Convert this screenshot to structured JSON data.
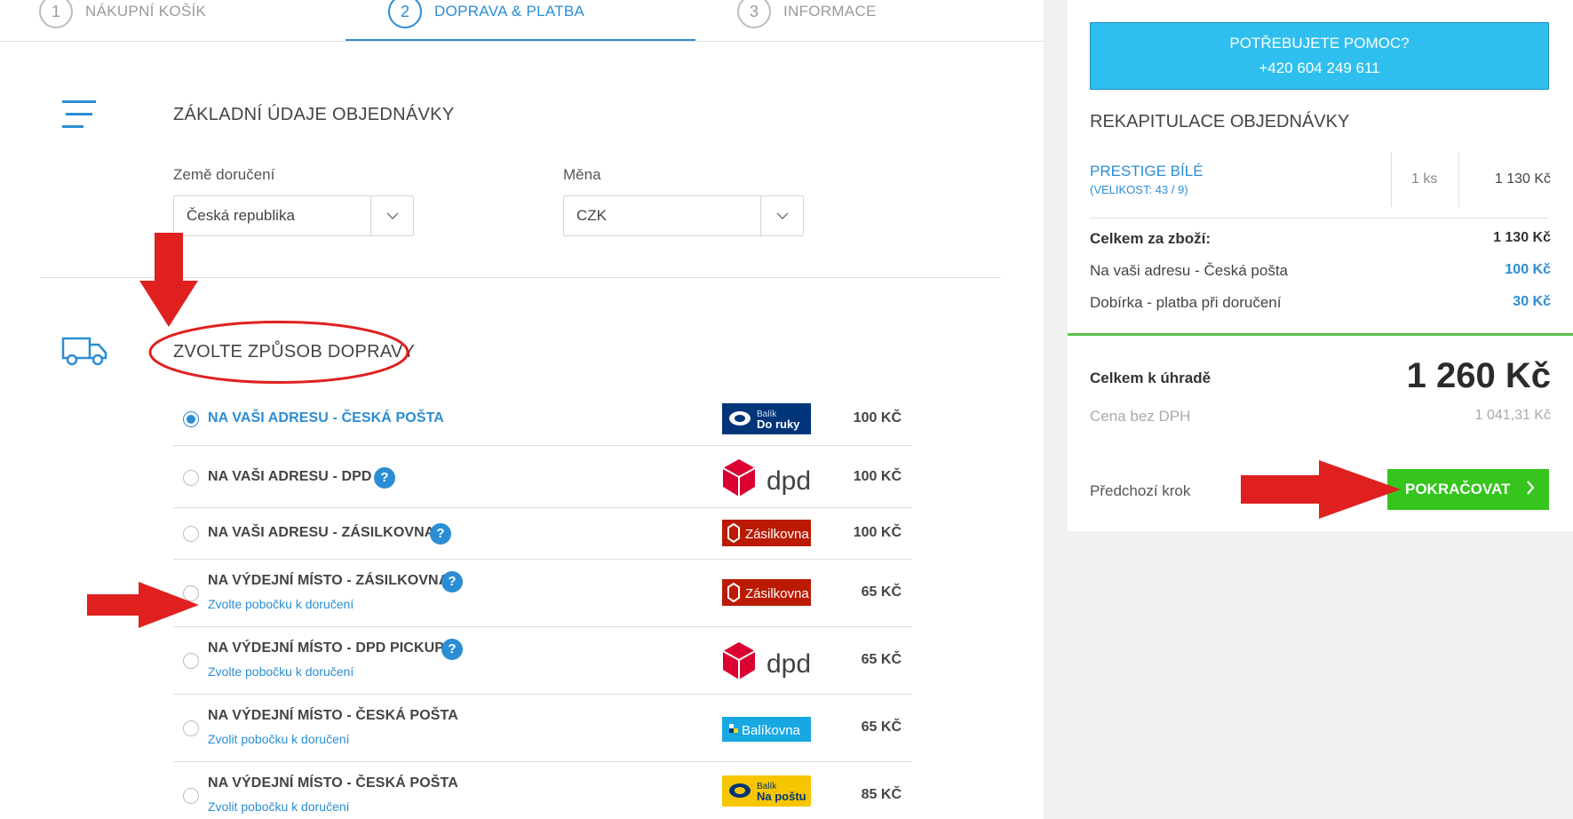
{
  "steps": [
    {
      "num": "1",
      "label": "NÁKUPNÍ KOŠÍK"
    },
    {
      "num": "2",
      "label": "DOPRAVA & PLATBA"
    },
    {
      "num": "3",
      "label": "INFORMACE"
    }
  ],
  "basic": {
    "title": "ZÁKLADNÍ ÚDAJE OBJEDNÁVKY",
    "country_label": "Země doručení",
    "country_value": "Česká republika",
    "currency_label": "Měna",
    "currency_value": "CZK"
  },
  "shipping": {
    "title": "ZVOLTE ZPŮSOB DOPRAVY",
    "options": [
      {
        "name": "NA VAŠI ADRESU - ČESKÁ POŠTA",
        "sub": "",
        "price": "100 KČ",
        "selected": true,
        "help": false,
        "logo": "balik-do-ruky",
        "logo_line1": "Balík",
        "logo_line2": "Do ruky"
      },
      {
        "name": "NA VAŠI ADRESU - DPD",
        "sub": "",
        "price": "100 KČ",
        "selected": false,
        "help": true,
        "logo": "dpd",
        "logo_text": "dpd"
      },
      {
        "name": "NA VAŠI ADRESU - ZÁSILKOVNA",
        "sub": "",
        "price": "100 KČ",
        "selected": false,
        "help": true,
        "logo": "zasilkovna",
        "logo_text": "Zásilkovna"
      },
      {
        "name": "NA VÝDEJNÍ MÍSTO - ZÁSILKOVNA",
        "sub": "Zvolte pobočku k doručení",
        "price": "65 KČ",
        "selected": false,
        "help": true,
        "logo": "zasilkovna",
        "logo_text": "Zásilkovna"
      },
      {
        "name": "NA VÝDEJNÍ MÍSTO - DPD PICKUP",
        "sub": "Zvolte pobočku k doručení",
        "price": "65 KČ",
        "selected": false,
        "help": true,
        "logo": "dpd",
        "logo_text": "dpd"
      },
      {
        "name": "NA VÝDEJNÍ MÍSTO - ČESKÁ POŠTA",
        "sub": "Zvolit pobočku k doručení",
        "price": "65 KČ",
        "selected": false,
        "help": false,
        "logo": "balikovna",
        "logo_text": "Balíkovna"
      },
      {
        "name": "NA VÝDEJNÍ MÍSTO - ČESKÁ POŠTA",
        "sub": "Zvolit pobočku k doručení",
        "price": "85 KČ",
        "selected": false,
        "help": false,
        "logo": "balik-na-postu",
        "logo_line1": "Balík",
        "logo_line2": "Na poštu"
      }
    ]
  },
  "summary": {
    "help_line1": "POTŘEBUJETE POMOC?",
    "help_line2": "+420 604 249 611",
    "recap_title": "REKAPITULACE OBJEDNÁVKY",
    "product_name": "PRESTIGE BÍLÉ",
    "product_size": "(VELIKOST: 43 / 9)",
    "qty": "1  ks",
    "product_price": "1 130 Kč",
    "goods_label": "Celkem za zboží:",
    "goods_value": "1 130 Kč",
    "delivery_label": "Na vaši adresu - Česká pošta",
    "delivery_value": "100 Kč",
    "payment_label": "Dobírka - platba při doručení",
    "payment_value": "30 Kč",
    "grand_label": "Celkem k úhradě",
    "grand_value": "1 260 Kč",
    "nodph_label": "Cena bez DPH",
    "nodph_value": "1 041,31 Kč",
    "prev_label": "Předchozí krok",
    "continue_label": "POKRAČOVAT"
  },
  "colors": {
    "accent": "#2b8dd3",
    "help_box": "#2fbfef",
    "continue": "#35c51c",
    "annotation": "#e0201f"
  }
}
